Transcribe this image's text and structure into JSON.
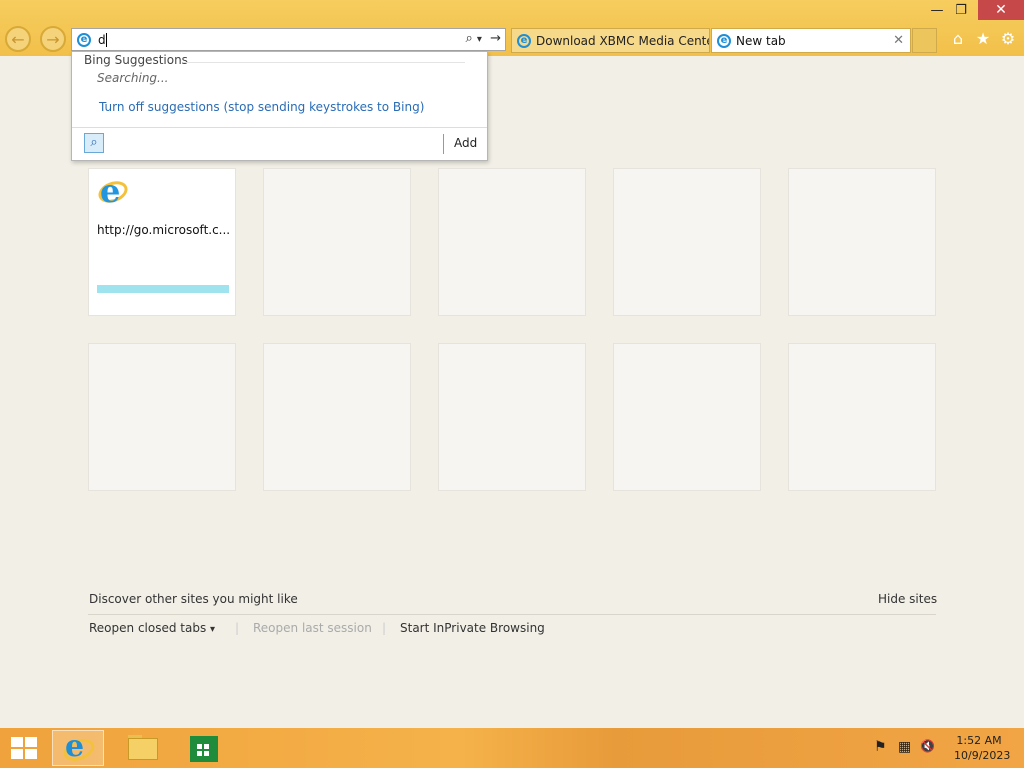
{
  "window": {
    "minimize_glyph": "—",
    "restore_glyph": "❐",
    "close_glyph": "✕"
  },
  "toolbar": {
    "back_glyph": "←",
    "forward_glyph": "→",
    "address_value": "d",
    "search_glyph": "⌕",
    "dropdown_glyph": "▾",
    "go_glyph": "→",
    "home_glyph": "⌂",
    "favorites_glyph": "★",
    "tools_glyph": "⚙"
  },
  "tabs": [
    {
      "label": "Download XBMC Media Cente...",
      "active": false
    },
    {
      "label": "New tab",
      "active": true,
      "close_glyph": "✕"
    }
  ],
  "suggestions": {
    "header": "Bing Suggestions",
    "status": "Searching...",
    "turn_off": "Turn off suggestions (stop sending keystrokes to Bing)",
    "add_label": "Add",
    "search_glyph": "⌕"
  },
  "tiles": [
    {
      "url": "http://go.microsoft.c...",
      "icon": "ie-icon",
      "load_progress": 1.0
    }
  ],
  "bottom": {
    "discover": "Discover other sites you might like",
    "hide_sites": "Hide sites",
    "reopen_closed": "Reopen closed tabs",
    "reopen_closed_arrow": "▾",
    "separator": "|",
    "reopen_last": "Reopen last session",
    "inprivate": "Start InPrivate Browsing"
  },
  "taskbar": {
    "tray_flag": "⚑",
    "tray_network": "▦",
    "tray_volume": "🔇",
    "time": "1:52 AM",
    "date": "10/9/2023"
  },
  "colors": {
    "chrome": "#f2c04a",
    "link": "#2a6cb6",
    "page_bg": "#f2efe6",
    "taskbar": "#f0a23c"
  }
}
